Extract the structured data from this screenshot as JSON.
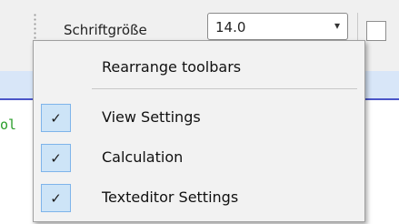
{
  "toolbar": {
    "font_size_label": "Schriftgröße",
    "font_size_value": "14.0",
    "font_size_arrow": "▾"
  },
  "editor": {
    "code_fragment": "ol"
  },
  "context_menu": {
    "rearrange_label": "Rearrange toolbars",
    "items": [
      {
        "label": "View Settings",
        "checked": true,
        "check_glyph": "✓"
      },
      {
        "label": "Calculation",
        "checked": true,
        "check_glyph": "✓"
      },
      {
        "label": "Texteditor Settings",
        "checked": true,
        "check_glyph": "✓"
      }
    ]
  }
}
